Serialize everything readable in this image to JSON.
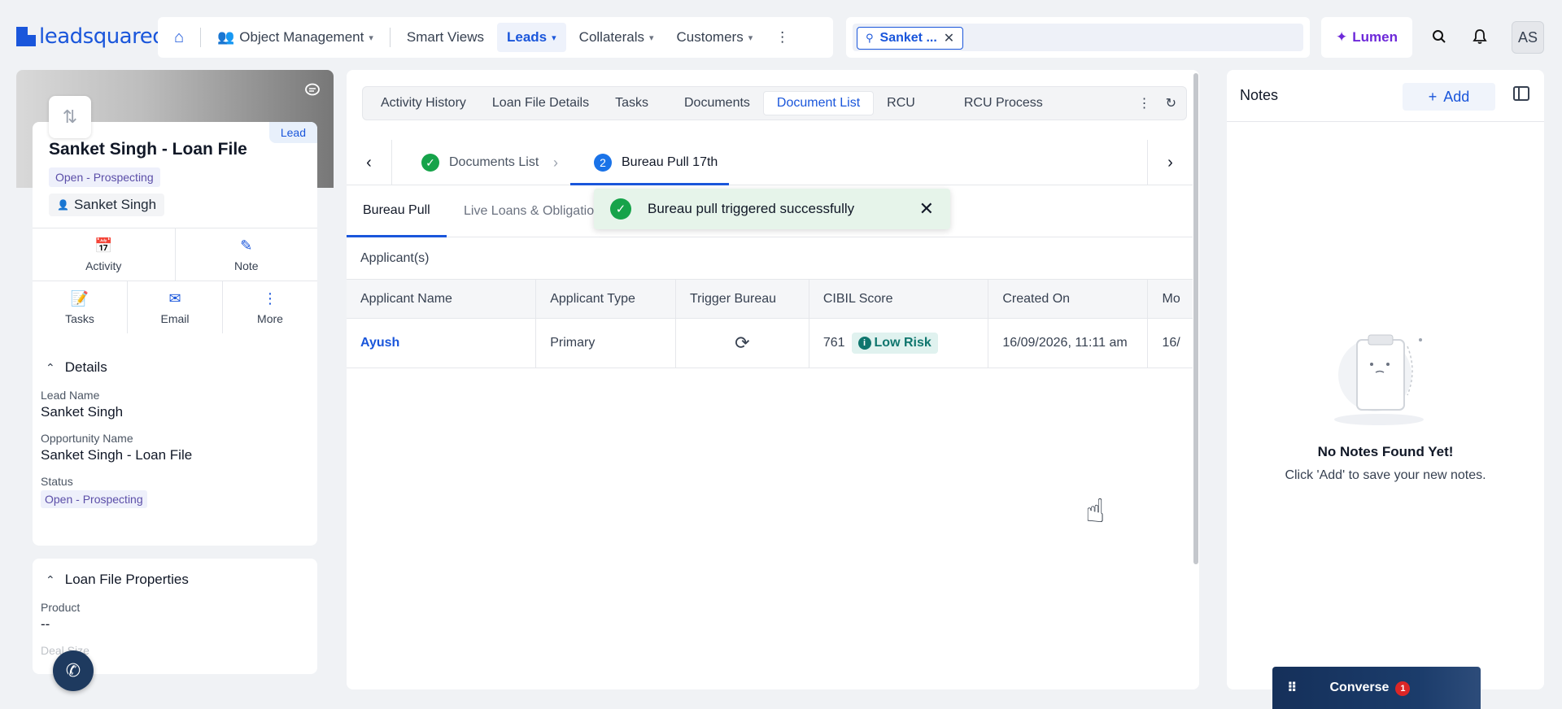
{
  "app": {
    "logo_text": "leadsquared",
    "nav": {
      "object_management": "Object Management",
      "smart_views": "Smart Views",
      "leads": "Leads",
      "collaterals": "Collaterals",
      "customers": "Customers"
    },
    "open_tab": "Sanket ...",
    "lumen": "Lumen",
    "avatar_initials": "AS"
  },
  "record": {
    "badge": "Lead",
    "title": "Sanket Singh - Loan File",
    "status": "Open - Prospecting",
    "owner": "Sanket Singh",
    "actions": {
      "activity": "Activity",
      "note": "Note",
      "tasks": "Tasks",
      "email": "Email",
      "more": "More"
    },
    "details": {
      "heading": "Details",
      "lead_name_label": "Lead Name",
      "lead_name": "Sanket Singh",
      "opportunity_name_label": "Opportunity Name",
      "opportunity_name": "Sanket Singh - Loan File",
      "status_label": "Status",
      "status": "Open - Prospecting"
    },
    "loan_props": {
      "heading": "Loan File Properties",
      "product_label": "Product",
      "product": "--",
      "next_label": "Deal Size"
    }
  },
  "main": {
    "tabs": [
      "Activity History",
      "Loan File Details",
      "Tasks",
      "Documents",
      "Document List",
      "RCU",
      "RCU Process"
    ],
    "active_tab": "Document List",
    "steps": {
      "step1": "Documents List",
      "step2_number": "2",
      "step2": "Bureau Pull 17th"
    },
    "subtabs": {
      "bureau_pull": "Bureau Pull",
      "live_loans": "Live Loans & Obligations"
    },
    "applicants_heading": "Applicant(s)",
    "columns": [
      "Applicant Name",
      "Applicant Type",
      "Trigger Bureau",
      "CIBIL Score",
      "Created On",
      "Mo"
    ],
    "rows": [
      {
        "name": "Ayush",
        "type": "Primary",
        "score": "761",
        "risk": "Low Risk",
        "created_on": "16/09/2026, 11:11 am",
        "modified": "16/"
      }
    ],
    "toast": "Bureau pull triggered successfully"
  },
  "notes": {
    "title": "Notes",
    "add": "Add",
    "empty_title": "No Notes Found Yet!",
    "empty_sub": "Click 'Add' to save your new notes."
  },
  "converse": {
    "label": "Converse",
    "badge": "1"
  }
}
